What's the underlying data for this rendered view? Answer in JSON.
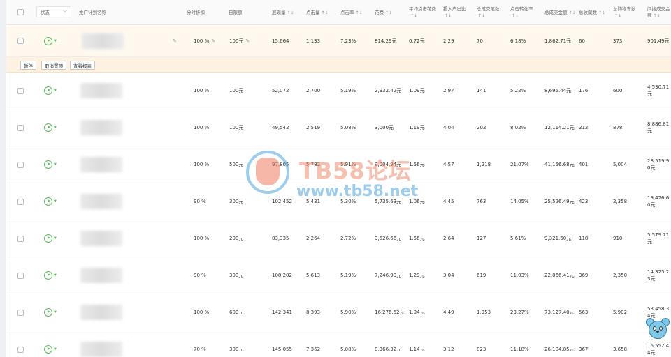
{
  "header": {
    "status_select": "状态",
    "columns": {
      "name": "推广计划名称",
      "discount": "分时折扣",
      "budget": "日限额",
      "impressions": "展现量",
      "clicks": "点击量",
      "ctr": "点击率",
      "cost": "花费",
      "cpc": "平均点击花费",
      "roi": "投入产出比",
      "transactions": "总成交笔数",
      "cvr": "点击转化率",
      "gmv": "总成交金额",
      "favorites": "总收藏数",
      "carts": "总购物车数",
      "indirect_gmv": "间接成交金额"
    },
    "sort_glyph": "↑↓"
  },
  "actions": {
    "pause": "暂停",
    "unpin": "取消置顶",
    "report": "查看报表"
  },
  "rows": [
    {
      "discount": "100 %",
      "budget": "100元",
      "impressions": "15,664",
      "clicks": "1,133",
      "ctr": "7.23%",
      "cost": "814.29元",
      "cpc": "0.72元",
      "roi": "2.29",
      "transactions": "70",
      "cvr": "6.18%",
      "gmv": "1,862.71元",
      "favorites": "60",
      "carts": "373",
      "indirect_gmv": "901.49元"
    },
    {
      "discount": "100 %",
      "budget": "100元",
      "impressions": "52,072",
      "clicks": "2,700",
      "ctr": "5.19%",
      "cost": "2,932.42元",
      "cpc": "1.09元",
      "roi": "2.97",
      "transactions": "141",
      "cvr": "5.22%",
      "gmv": "8,695.44元",
      "favorites": "176",
      "carts": "600",
      "indirect_gmv": "4,530.71元"
    },
    {
      "discount": "100 %",
      "budget": "100元",
      "impressions": "49,542",
      "clicks": "2,519",
      "ctr": "5.08%",
      "cost": "3,000元",
      "cpc": "1.19元",
      "roi": "4.04",
      "transactions": "202",
      "cvr": "8.02%",
      "gmv": "12,114.21元",
      "favorites": "212",
      "carts": "878",
      "indirect_gmv": "8,886.81元"
    },
    {
      "discount": "100 %",
      "budget": "500元",
      "impressions": "97,805",
      "clicks": "5,782",
      "ctr": "5.91%",
      "cost": "9,004.94元",
      "cpc": "1.56元",
      "roi": "4.57",
      "transactions": "1,218",
      "cvr": "21.07%",
      "gmv": "41,156.68元",
      "favorites": "401",
      "carts": "5,004",
      "indirect_gmv": "28,519.90元"
    },
    {
      "discount": "90 %",
      "budget": "300元",
      "impressions": "102,452",
      "clicks": "5,431",
      "ctr": "5.30%",
      "cost": "5,735.63元",
      "cpc": "1.06元",
      "roi": "4.45",
      "transactions": "763",
      "cvr": "14.05%",
      "gmv": "25,526.49元",
      "favorites": "423",
      "carts": "2,358",
      "indirect_gmv": "19,476.60元"
    },
    {
      "discount": "100 %",
      "budget": "200元",
      "impressions": "83,335",
      "clicks": "2,264",
      "ctr": "2.72%",
      "cost": "3,526.66元",
      "cpc": "1.56元",
      "roi": "2.64",
      "transactions": "127",
      "cvr": "5.61%",
      "gmv": "9,321.60元",
      "favorites": "118",
      "carts": "910",
      "indirect_gmv": "5,579.71元"
    },
    {
      "discount": "90 %",
      "budget": "300元",
      "impressions": "108,202",
      "clicks": "5,613",
      "ctr": "5.19%",
      "cost": "7,246.90元",
      "cpc": "1.29元",
      "roi": "3.04",
      "transactions": "619",
      "cvr": "11.03%",
      "gmv": "22,066.41元",
      "favorites": "369",
      "carts": "2,350",
      "indirect_gmv": "14,325.23元"
    },
    {
      "discount": "100 %",
      "budget": "600元",
      "impressions": "142,341",
      "clicks": "8,393",
      "ctr": "5.90%",
      "cost": "16,276.52元",
      "cpc": "1.94元",
      "roi": "4.49",
      "transactions": "1,953",
      "cvr": "23.27%",
      "gmv": "73,127.40元",
      "favorites": "563",
      "carts": "5,902",
      "indirect_gmv": "53,458.34元"
    },
    {
      "discount": "70 %",
      "budget": "300元",
      "impressions": "145,055",
      "clicks": "7,362",
      "ctr": "5.08%",
      "cost": "8,366.32元",
      "cpc": "1.14元",
      "roi": "3.12",
      "transactions": "823",
      "cvr": "11.18%",
      "gmv": "26,104.85元",
      "favorites": "367",
      "carts": "3,658",
      "indirect_gmv": "16,552.44元"
    }
  ],
  "watermark": {
    "title": "TB58论坛",
    "url": "www.tb58.net"
  },
  "colors": {
    "play_icon": "#5cb85c",
    "highlight_row": "#fff8ef",
    "action_bar": "#fdf1e1"
  }
}
